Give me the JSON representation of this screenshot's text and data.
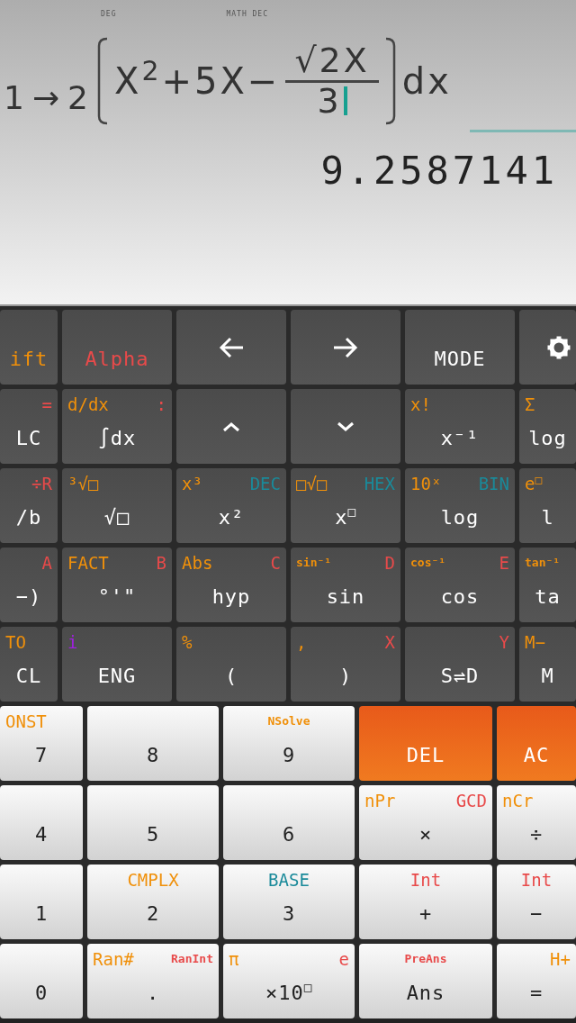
{
  "display": {
    "indicators": [
      {
        "text": "DEG"
      },
      {
        "text": "MATH DEC"
      }
    ],
    "expression": {
      "lower": "1",
      "arrow": "→",
      "upper": "2",
      "body": "X$^{2}$+5X−",
      "numerator": "√2X",
      "denominator": "3",
      "tail": "dx"
    },
    "result": "9.2587141"
  },
  "function_keys": [
    [
      {
        "kind": "shift",
        "main": {
          "text": "ift"
        }
      },
      {
        "kind": "alpha",
        "main": {
          "text": "Alpha"
        }
      },
      {
        "kind": "left"
      },
      {
        "kind": "right"
      },
      {
        "kind": "text",
        "main": {
          "text": "MODE"
        }
      },
      {
        "kind": "settings"
      }
    ],
    [
      {
        "kind": "text",
        "main": {
          "text": "LC"
        },
        "top_right": {
          "text": "=",
          "color": "#e84a4a"
        }
      },
      {
        "kind": "text",
        "main": {
          "text": "∫dx"
        },
        "top_left": {
          "text": "d/dx",
          "color": "#f0900a"
        },
        "top_right": {
          "text": ":",
          "color": "#e84a4a"
        }
      },
      {
        "kind": "up"
      },
      {
        "kind": "down"
      },
      {
        "kind": "text",
        "main": {
          "text": "x⁻¹"
        },
        "top_left": {
          "text": "x!",
          "color": "#f0900a"
        }
      },
      {
        "kind": "text",
        "main": {
          "text": "log"
        },
        "top_left": {
          "text": "Σ",
          "color": "#f0900a"
        }
      }
    ],
    [
      {
        "kind": "text",
        "main": {
          "text": "/b"
        },
        "top_right": {
          "text": "÷R",
          "color": "#e84a4a"
        }
      },
      {
        "kind": "text",
        "main": {
          "text": "√□"
        },
        "top_left": {
          "text": "³√□",
          "color": "#f0900a"
        }
      },
      {
        "kind": "text",
        "main": {
          "text": "x²"
        },
        "top_left": {
          "text": "x³",
          "color": "#f0900a"
        },
        "top_right": {
          "text": "DEC",
          "color": "#1a8a9a"
        }
      },
      {
        "kind": "text",
        "main": {
          "text": "x$^{□}$"
        },
        "top_left": {
          "text": "□√□",
          "color": "#f0900a"
        },
        "top_right": {
          "text": "HEX",
          "color": "#1a8a9a"
        }
      },
      {
        "kind": "text",
        "main": {
          "text": "log"
        },
        "top_left": {
          "text": "10ˣ",
          "color": "#f0900a"
        },
        "top_right": {
          "text": "BIN",
          "color": "#1a8a9a"
        }
      },
      {
        "kind": "text",
        "main": {
          "text": "l"
        },
        "top_left": {
          "text": "e$^{□}$",
          "color": "#f0900a"
        }
      }
    ],
    [
      {
        "kind": "text",
        "main": {
          "text": "−)"
        },
        "top_right": {
          "text": "A",
          "color": "#e84a4a"
        }
      },
      {
        "kind": "text",
        "main": {
          "text": "°'\""
        },
        "top_left": {
          "text": "FACT",
          "color": "#f0900a"
        },
        "top_right": {
          "text": "B",
          "color": "#e84a4a"
        }
      },
      {
        "kind": "text",
        "main": {
          "text": "hyp"
        },
        "top_left": {
          "text": "Abs",
          "color": "#f0900a"
        },
        "top_right": {
          "text": "C",
          "color": "#e84a4a"
        }
      },
      {
        "kind": "text",
        "main": {
          "text": "sin"
        },
        "top_left": {
          "text": "sin⁻¹",
          "color": "#f0900a"
        },
        "top_right": {
          "text": "D",
          "color": "#e84a4a"
        }
      },
      {
        "kind": "text",
        "main": {
          "text": "cos"
        },
        "top_left": {
          "text": "cos⁻¹",
          "color": "#f0900a"
        },
        "top_right": {
          "text": "E",
          "color": "#e84a4a"
        }
      },
      {
        "kind": "text",
        "main": {
          "text": "ta"
        },
        "top_left": {
          "text": "tan⁻¹",
          "color": "#f0900a"
        }
      }
    ],
    [
      {
        "kind": "text",
        "main": {
          "text": "CL"
        },
        "top_left": {
          "text": "TO",
          "color": "#f0900a"
        }
      },
      {
        "kind": "text",
        "main": {
          "text": "ENG"
        },
        "top_left": {
          "text": "i",
          "color": "#a020e0"
        }
      },
      {
        "kind": "text",
        "main": {
          "text": "("
        },
        "top_left": {
          "text": "%",
          "color": "#f0900a"
        }
      },
      {
        "kind": "text",
        "main": {
          "text": ")"
        },
        "top_left": {
          "text": ",",
          "color": "#f0900a"
        },
        "top_right": {
          "text": "X",
          "color": "#e84a4a"
        }
      },
      {
        "kind": "text",
        "main": {
          "text": "S⇌D"
        },
        "top_right": {
          "text": "Y",
          "color": "#e84a4a"
        }
      },
      {
        "kind": "text",
        "main": {
          "text": "M"
        },
        "top_left": {
          "text": "M−",
          "color": "#f0900a"
        }
      }
    ]
  ],
  "number_keys": [
    [
      {
        "kind": "digit",
        "main": "7",
        "top_left": {
          "text": "ONST",
          "color": "#f0900a"
        }
      },
      {
        "kind": "digit",
        "main": "8"
      },
      {
        "kind": "digit",
        "main": "9",
        "top_center": {
          "text": "NSolve",
          "color": "#f0900a"
        }
      },
      {
        "kind": "accent",
        "main": "DEL"
      },
      {
        "kind": "accent",
        "main": "AC"
      }
    ],
    [
      {
        "kind": "digit",
        "main": "4"
      },
      {
        "kind": "digit",
        "main": "5"
      },
      {
        "kind": "digit",
        "main": "6"
      },
      {
        "kind": "digit",
        "main": "×",
        "top_left": {
          "text": "nPr",
          "color": "#f0900a"
        },
        "top_right": {
          "text": "GCD",
          "color": "#e84a4a"
        }
      },
      {
        "kind": "digit",
        "main": "÷",
        "top_left": {
          "text": "nCr",
          "color": "#f0900a"
        }
      }
    ],
    [
      {
        "kind": "digit",
        "main": "1"
      },
      {
        "kind": "digit",
        "main": "2",
        "top_center": {
          "text": "CMPLX",
          "color": "#f0900a"
        }
      },
      {
        "kind": "digit",
        "main": "3",
        "top_center": {
          "text": "BASE",
          "color": "#1a8a9a"
        }
      },
      {
        "kind": "digit",
        "main": "+",
        "top_center": {
          "text": "Int",
          "color": "#e84a4a"
        }
      },
      {
        "kind": "digit",
        "main": "−",
        "top_center": {
          "text": "Int",
          "color": "#e84a4a"
        }
      }
    ],
    [
      {
        "kind": "digit",
        "main": "0"
      },
      {
        "kind": "digit",
        "main": ".",
        "top_left": {
          "text": "Ran#",
          "color": "#f0900a"
        },
        "top_right": {
          "text": "RanInt",
          "color": "#e84a4a"
        }
      },
      {
        "kind": "digit",
        "main": "×10$^{□}$",
        "top_left": {
          "text": "π",
          "color": "#f0900a"
        },
        "top_right": {
          "text": "e",
          "color": "#e84a4a"
        }
      },
      {
        "kind": "digit",
        "main": "Ans",
        "top_center": {
          "text": "PreAns",
          "color": "#e84a4a"
        }
      },
      {
        "kind": "digit",
        "main": "=",
        "top_right": {
          "text": "H+",
          "color": "#f0900a"
        }
      }
    ]
  ]
}
